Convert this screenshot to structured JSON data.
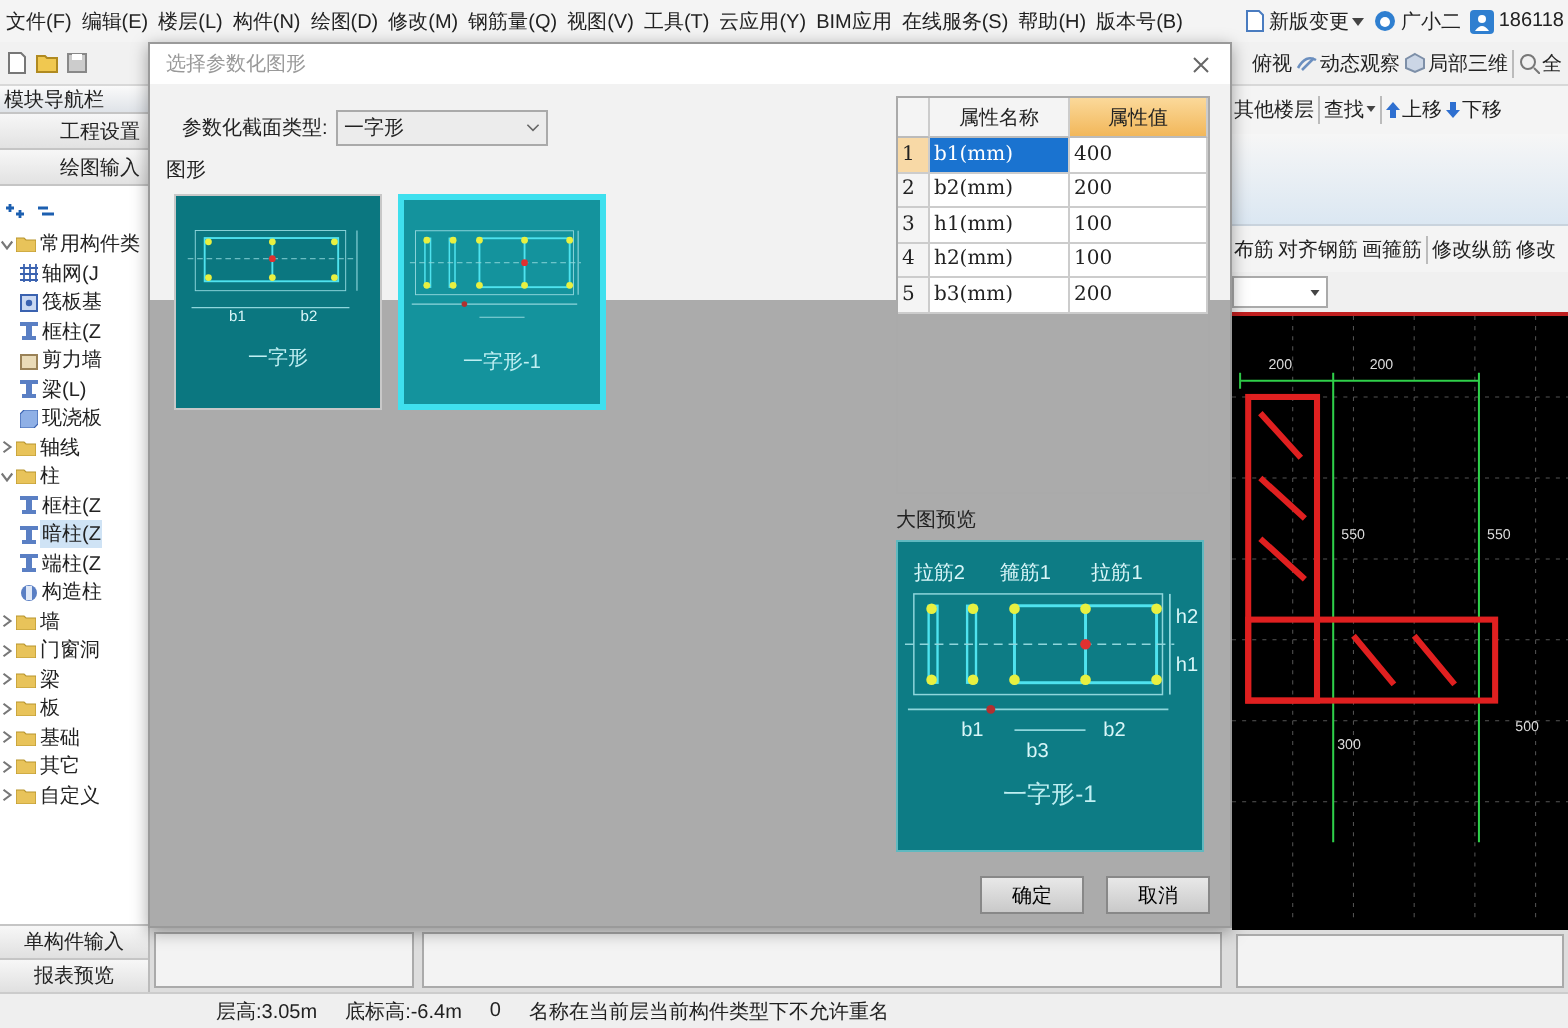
{
  "menu": [
    "文件(F)",
    "编辑(E)",
    "楼层(L)",
    "构件(N)",
    "绘图(D)",
    "修改(M)",
    "钢筋量(Q)",
    "视图(V)",
    "工具(T)",
    "云应用(Y)",
    "BIM应用",
    "在线服务(S)",
    "帮助(H)",
    "版本号(B)"
  ],
  "account": {
    "news": "新版变更",
    "assistant": "广小二",
    "user": "186118"
  },
  "view_toolbar": [
    "俯视",
    "动态观察",
    "局部三维",
    "全"
  ],
  "edit_toolbar": [
    "其他楼层",
    "查找",
    "上移",
    "下移"
  ],
  "rebar_toolbar": [
    "布筋",
    "对齐钢筋",
    "画箍筋",
    "修改纵筋",
    "修改"
  ],
  "nav": {
    "title": "模块导航栏",
    "sections": [
      "工程设置",
      "绘图输入"
    ],
    "tree": [
      {
        "label": "常用构件类",
        "expanded": true,
        "selected": false,
        "children": [
          {
            "label": "轴网(J",
            "kind": "grid",
            "selected": false
          },
          {
            "label": "筏板基",
            "kind": "footing",
            "selected": false
          },
          {
            "label": "框柱(Z",
            "kind": "column",
            "selected": false
          },
          {
            "label": "剪力墙",
            "kind": "wall",
            "selected": false
          },
          {
            "label": "梁(L)",
            "kind": "column",
            "selected": false
          },
          {
            "label": "现浇板",
            "kind": "slab",
            "selected": false
          }
        ]
      },
      {
        "label": "轴线",
        "expanded": false,
        "selected": false
      },
      {
        "label": "柱",
        "expanded": true,
        "selected": false,
        "children": [
          {
            "label": "框柱(Z",
            "kind": "column",
            "selected": false
          },
          {
            "label": "暗柱(Z",
            "kind": "column",
            "selected": true
          },
          {
            "label": "端柱(Z",
            "kind": "column",
            "selected": false
          },
          {
            "label": "构造柱",
            "kind": "pillar",
            "selected": false
          }
        ]
      },
      {
        "label": "墙",
        "expanded": false,
        "selected": false
      },
      {
        "label": "门窗洞",
        "expanded": false,
        "selected": false
      },
      {
        "label": "梁",
        "expanded": false,
        "selected": false
      },
      {
        "label": "板",
        "expanded": false,
        "selected": false
      },
      {
        "label": "基础",
        "expanded": false,
        "selected": false
      },
      {
        "label": "其它",
        "expanded": false,
        "selected": false
      },
      {
        "label": "自定义",
        "expanded": false,
        "selected": false
      }
    ],
    "bottom": [
      "单构件输入",
      "报表预览"
    ]
  },
  "canvas": {
    "labels": [
      "200",
      "200",
      "550",
      "550",
      "500",
      "300"
    ]
  },
  "dialog": {
    "title": "选择参数化图形",
    "type_label": "参数化截面类型:",
    "type_value": "一字形",
    "shapes_label": "图形",
    "shapes": [
      {
        "caption": "一字形",
        "kind": "two-bay",
        "selected": false,
        "labels": [
          "b1",
          "b2"
        ]
      },
      {
        "caption": "一字形-1",
        "kind": "four-bay",
        "selected": true
      }
    ],
    "table": {
      "columns": [
        "属性名称",
        "属性值"
      ],
      "rows": [
        {
          "index": "1",
          "name": "b1(mm)",
          "value": "400",
          "selected": true
        },
        {
          "index": "2",
          "name": "b2(mm)",
          "value": "200",
          "selected": false
        },
        {
          "index": "3",
          "name": "h1(mm)",
          "value": "100",
          "selected": false
        },
        {
          "index": "4",
          "name": "h2(mm)",
          "value": "100",
          "selected": false
        },
        {
          "index": "5",
          "name": "b3(mm)",
          "value": "200",
          "selected": false
        }
      ]
    },
    "preview_label": "大图预览",
    "preview": {
      "caption": "一字形-1",
      "kind": "four-bay",
      "labels": [
        "拉筋2",
        "箍筋1",
        "拉筋1",
        "b1",
        "b2",
        "b3",
        "h2",
        "h1"
      ]
    },
    "buttons": [
      "确定",
      "取消"
    ]
  },
  "status_bar": [
    "层高:3.05m",
    "底标高:-6.4m",
    "0",
    "名称在当前层当前构件类型下不允许重名"
  ]
}
